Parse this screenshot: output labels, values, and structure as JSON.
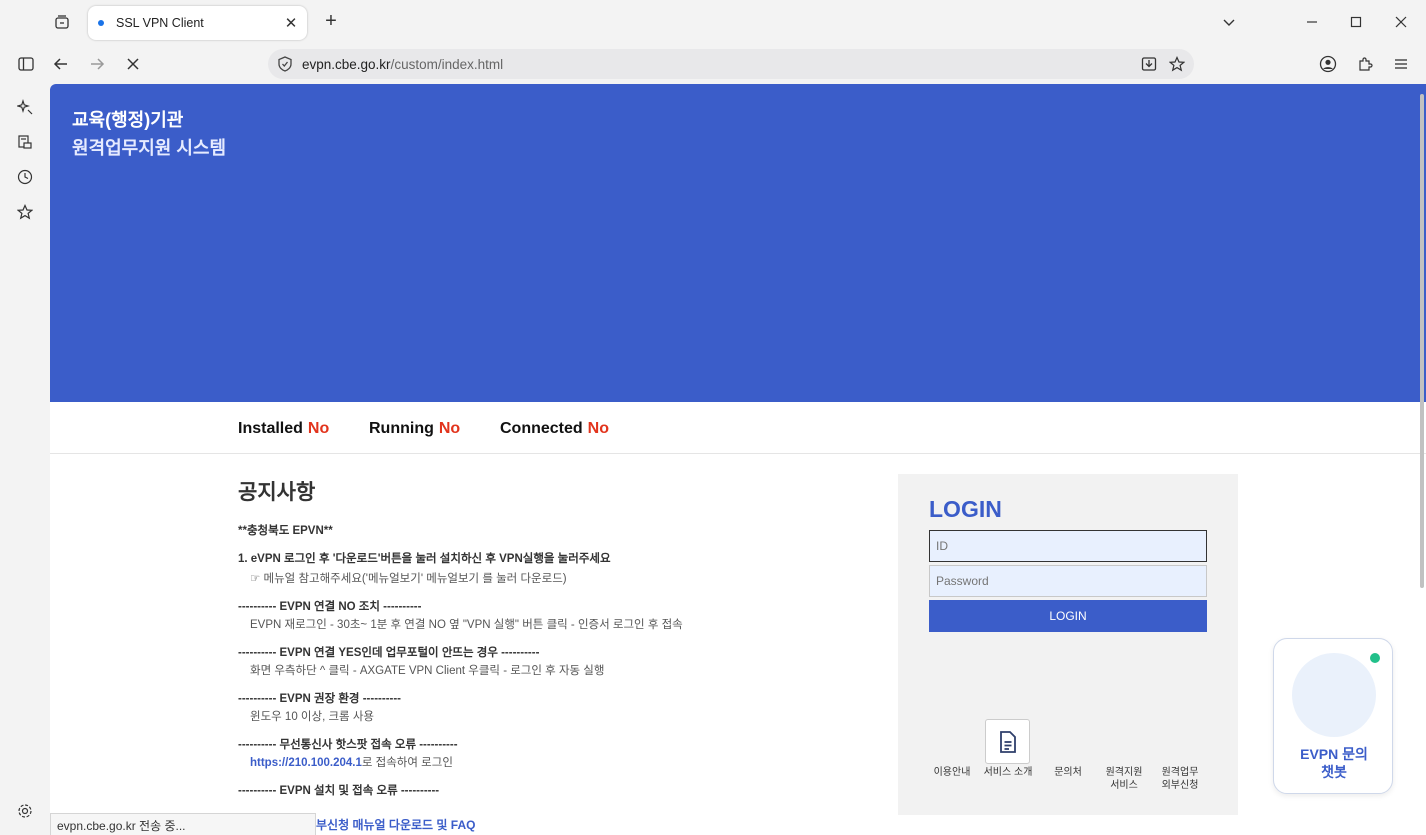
{
  "browser": {
    "tab_title": "SSL VPN Client",
    "url_domain": "evpn.cbe.go.kr",
    "url_path": "/custom/index.html",
    "status_text": "evpn.cbe.go.kr 전송 중..."
  },
  "hero": {
    "line1": "교육(행정)기관",
    "line2": "원격업무지원 시스템"
  },
  "status": {
    "installed_label": "Installed",
    "installed_value": "No",
    "running_label": "Running",
    "running_value": "No",
    "connected_label": "Connected",
    "connected_value": "No"
  },
  "notice": {
    "title": "공지사항",
    "l1": "**충청북도 EPVN**",
    "l2": "1. eVPN 로그인 후 '다운로드'버튼을 눌러 설치하신 후 VPN실행을 눌러주세요",
    "l3": "☞ 메뉴얼 참고해주세요('메뉴얼보기' 메뉴얼보기 를 눌러 다운로드)",
    "l4": "---------- EVPN 연결 NO 조치 ----------",
    "l5": "EVPN 재로그인 - 30초~ 1분 후 연결 NO 옆 \"VPN 실행\" 버튼 클릭 - 인증서 로그인 후 접속",
    "l6": "---------- EVPN 연결 YES인데 업무포털이 안뜨는 경우 ----------",
    "l7": "화면 우측하단 ^ 클릭 - AXGATE VPN Client 우클릭 - 로그인 후 자동 실행",
    "l8": "---------- EVPN 권장 환경 ----------",
    "l9": "윈도우 10 이상, 크롬 사용",
    "l10": "---------- 무선통신사 핫스팟 접속 오류 ----------",
    "l11_link": "https://210.100.204.1",
    "l11_rest": "로 접속하여 로그인",
    "l12": "---------- EVPN 설치 및 접속 오류 ----------",
    "footer_link": "부신청 매뉴얼 다운로드 및 FAQ"
  },
  "login": {
    "title": "LOGIN",
    "id_placeholder": "ID",
    "pw_placeholder": "Password",
    "button": "LOGIN",
    "services": [
      "이용안내",
      "서비스 소개",
      "문의처",
      "원격지원\n서비스",
      "원격업무\n외부신청"
    ]
  },
  "chatbot": {
    "label_line1": "EVPN 문의",
    "label_line2": "챗봇"
  }
}
